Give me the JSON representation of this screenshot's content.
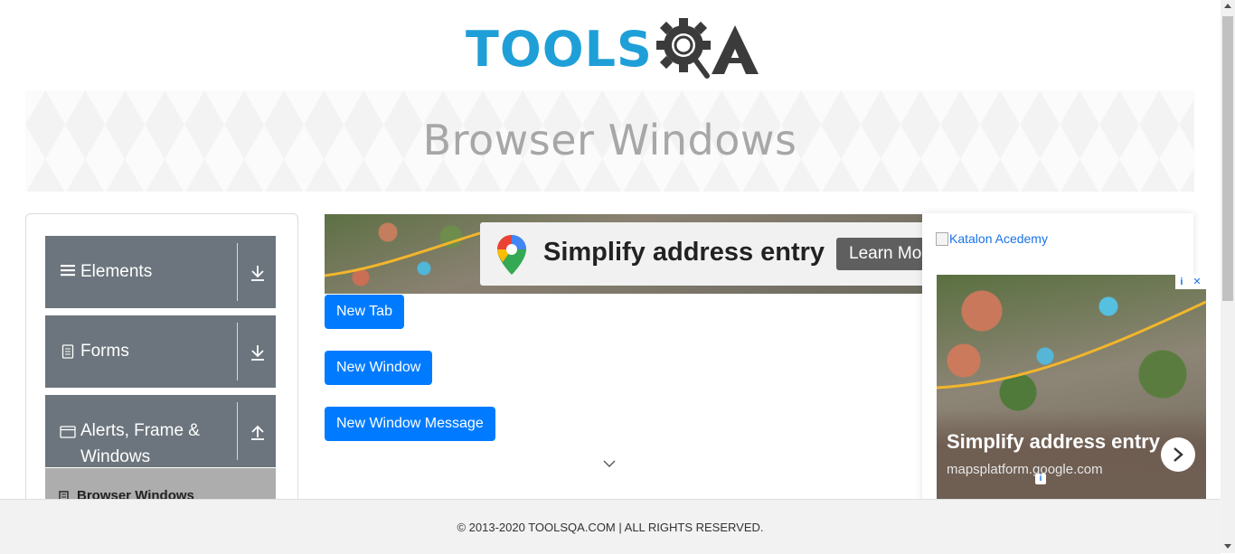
{
  "header": {
    "logo_left": "TOOLS",
    "logo_right": "QA",
    "brand_colors": {
      "tools": "#1f9fd8",
      "qa": "#3b3b3b"
    }
  },
  "banner": {
    "title": "Browser Windows"
  },
  "sidebar": {
    "groups": [
      {
        "label": "Elements",
        "icon": "hamburger-icon",
        "arrow": "download-arrow-icon"
      },
      {
        "label": "Forms",
        "icon": "document-icon",
        "arrow": "download-arrow-icon"
      },
      {
        "label": "Alerts, Frame & Windows",
        "icon": "window-icon",
        "arrow": "upload-arrow-icon"
      }
    ],
    "active_item": {
      "label": "Browser Windows",
      "icon": "document-icon"
    }
  },
  "ad_top": {
    "headline": "Simplify address entry",
    "cta": "Learn More",
    "icon": "google-maps-pin-icon"
  },
  "buttons": {
    "new_tab": "New Tab",
    "new_window": "New Window",
    "new_window_message": "New Window Message"
  },
  "right_panel": {
    "katalon_alt": "Katalon Acedemy",
    "ad_headline": "Simplify address entry",
    "ad_domain": "mapsplatform.google.com",
    "adchoices_info": "i",
    "adchoices_close": "✕"
  },
  "footer": {
    "text": "© 2013-2020 TOOLSQA.COM | ALL RIGHTS RESERVED."
  },
  "colors": {
    "primary_button": "#007bff",
    "sidebar_group": "#6c757d",
    "active_item": "#adadad"
  }
}
